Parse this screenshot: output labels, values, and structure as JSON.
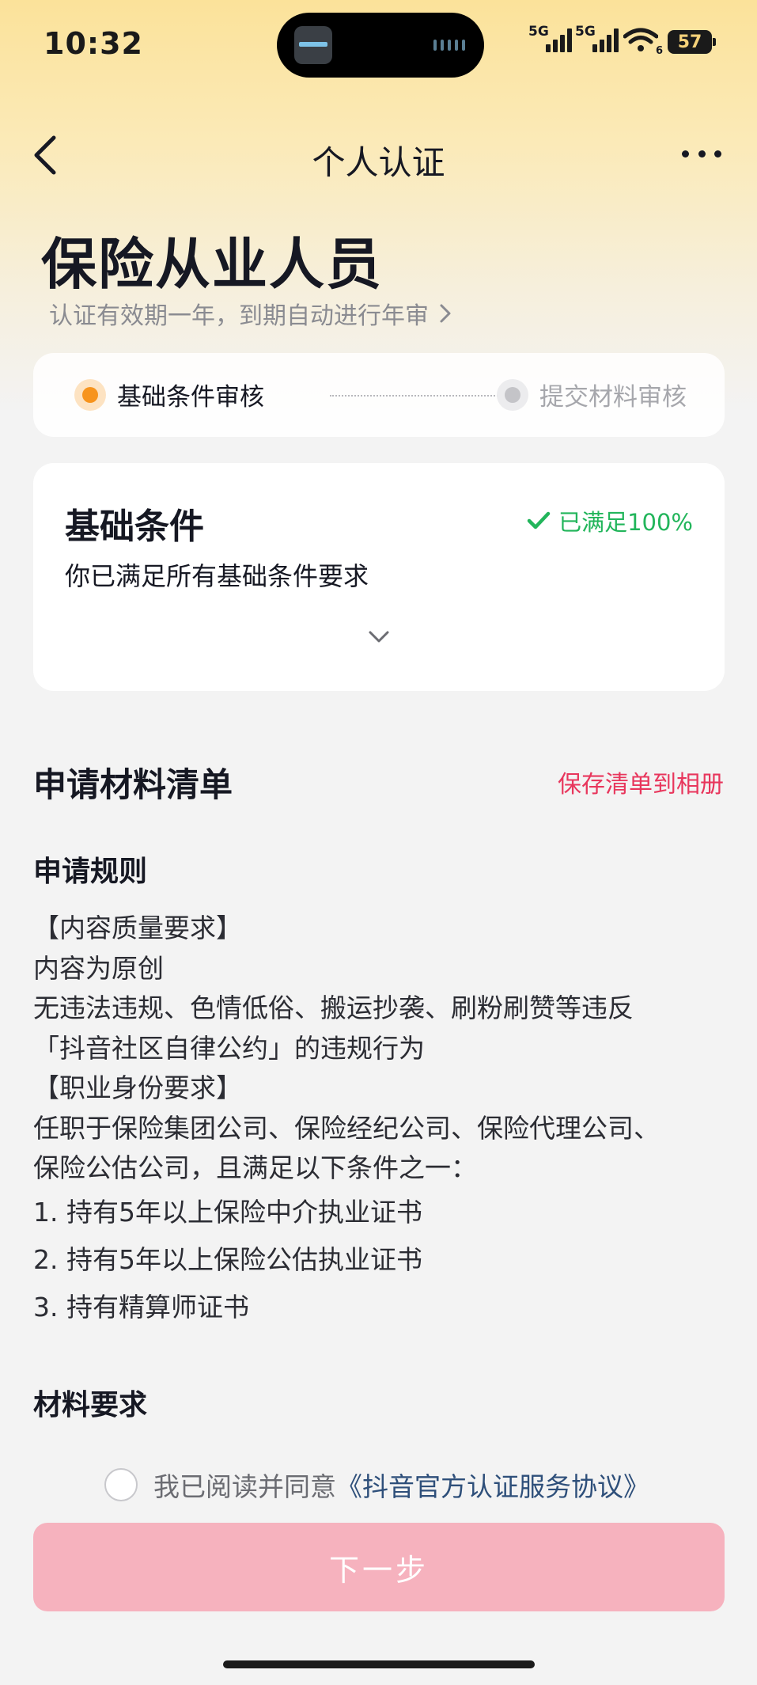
{
  "status_bar": {
    "time": "10:32",
    "signal1_label": "5G",
    "signal2_label": "5G",
    "wifi_sub": "6",
    "battery": "57"
  },
  "nav": {
    "title": "个人认证"
  },
  "header": {
    "title": "保险从业人员",
    "subtitle": "认证有效期一年，到期自动进行年审"
  },
  "steps": [
    {
      "label": "基础条件审核",
      "state": "active",
      "color": "#f7941d"
    },
    {
      "label": "提交材料审核",
      "state": "inactive",
      "color": "#c4c4c8"
    }
  ],
  "conditions": {
    "title": "基础条件",
    "status": "已满足100%",
    "description": "你已满足所有基础条件要求"
  },
  "materials": {
    "section_title": "申请材料清单",
    "save_link": "保存清单到相册",
    "rules_title": "申请规则",
    "rules_lines": [
      "【内容质量要求】",
      "内容为原创",
      "无违法违规、色情低俗、搬运抄袭、刷粉刷赞等违反",
      "「抖音社区自律公约」的违规行为",
      "【职业身份要求】",
      "任职于保险集团公司、保险经纪公司、保险代理公司、",
      "保险公估公司，且满足以下条件之一："
    ],
    "requirements": [
      "1.  持有5年以上保险中介执业证书",
      "2.  持有5年以上保险公估执业证书",
      "3.  持有精算师证书"
    ],
    "materials_title": "材料要求"
  },
  "agreement": {
    "prefix": "我已阅读并同意",
    "link": "《抖音官方认证服务协议》",
    "checked": false
  },
  "next_button": {
    "label": "下一步",
    "enabled": false
  },
  "colors": {
    "accent_pink": "#e8365c",
    "success_green": "#22b55b",
    "active_step": "#f7941d",
    "button_disabled": "#f6b2be"
  }
}
